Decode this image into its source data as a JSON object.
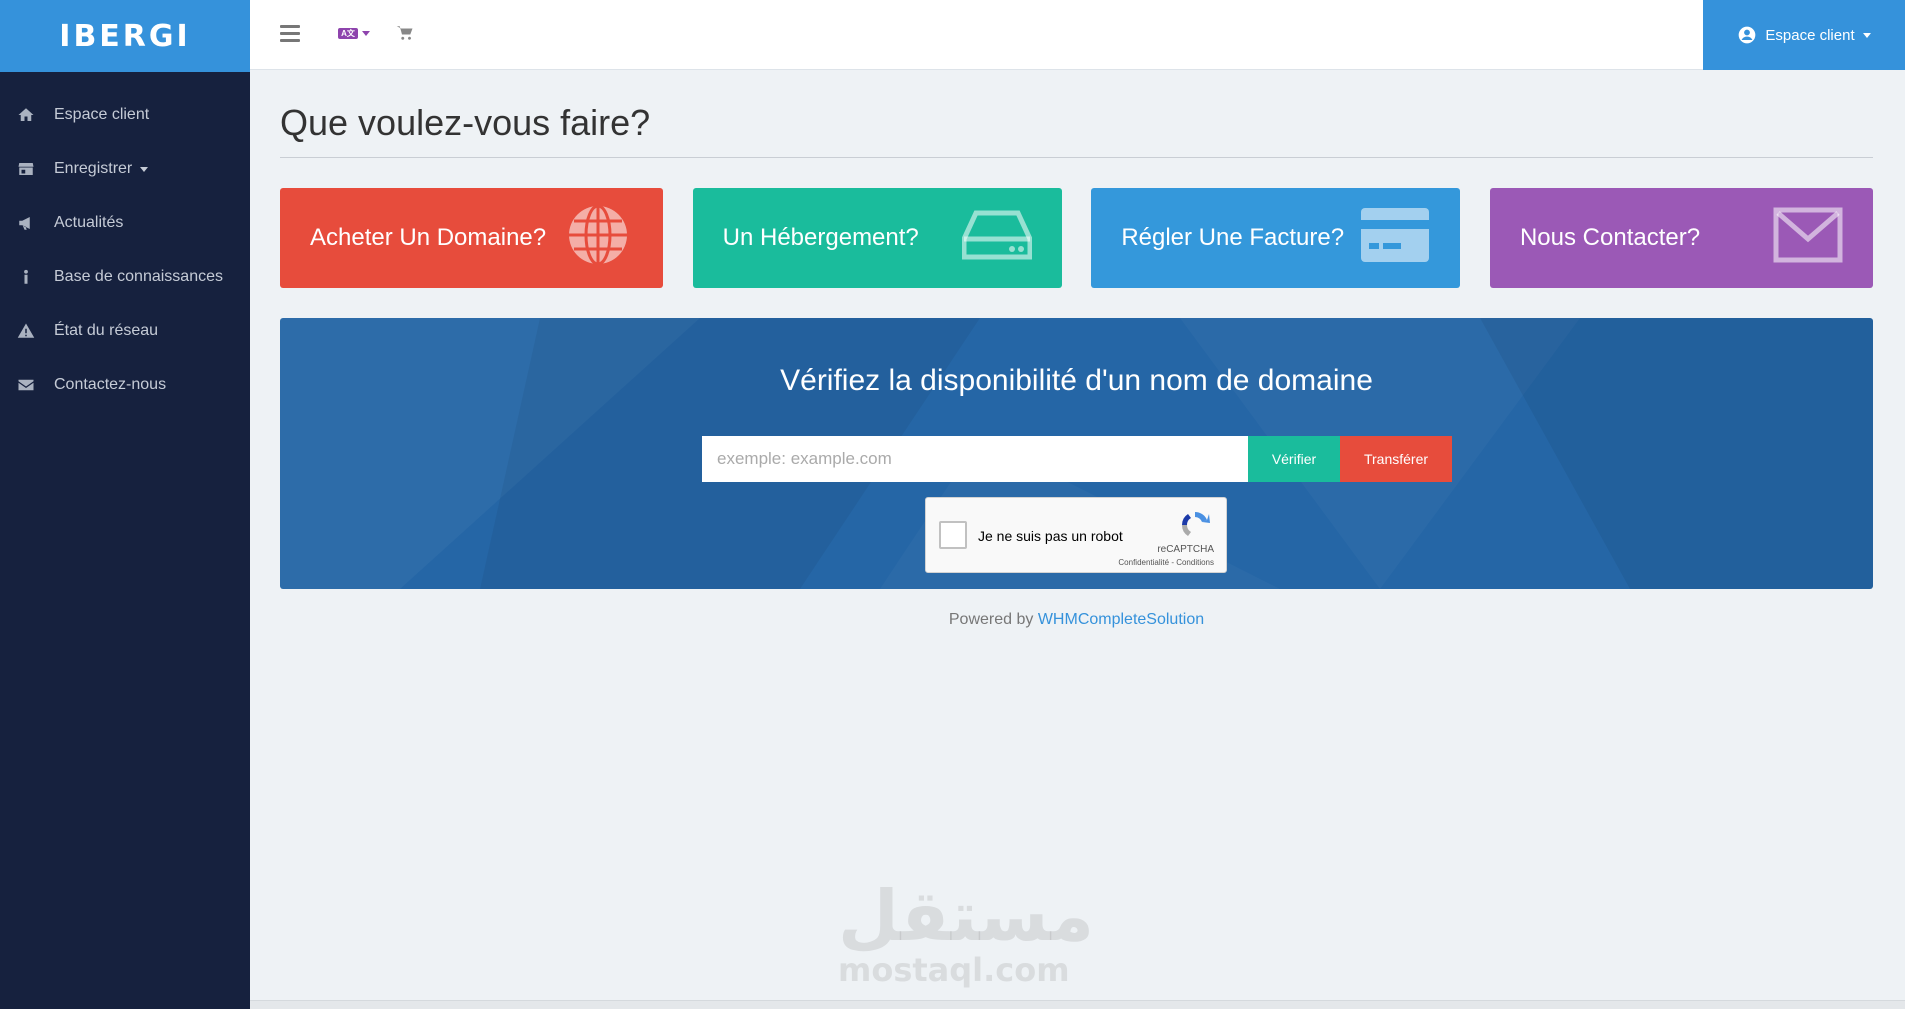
{
  "brand": {
    "logo": "IBERGI"
  },
  "sidebar": {
    "items": [
      {
        "label": "Espace client",
        "icon": "home-icon"
      },
      {
        "label": "Enregistrer",
        "icon": "store-icon",
        "has_caret": true
      },
      {
        "label": "Actualités",
        "icon": "megaphone-icon"
      },
      {
        "label": "Base de connaissances",
        "icon": "info-icon"
      },
      {
        "label": "État du réseau",
        "icon": "warning-icon"
      },
      {
        "label": "Contactez-nous",
        "icon": "envelope-icon"
      }
    ]
  },
  "topbar": {
    "language_flag": "A文",
    "account_label": "Espace client"
  },
  "main": {
    "title": "Que voulez-vous faire?",
    "cards": [
      {
        "label": "Acheter Un Domaine?",
        "icon": "globe-icon",
        "color": "#e74c3c"
      },
      {
        "label": "Un Hébergement?",
        "icon": "server-icon",
        "color": "#1abc9c"
      },
      {
        "label": "Régler Une Facture?",
        "icon": "credit-card-icon",
        "color": "#3498db"
      },
      {
        "label": "Nous Contacter?",
        "icon": "envelope-icon",
        "color": "#9b59b6"
      }
    ],
    "domain_search": {
      "title": "Vérifiez la disponibilité d'un nom de domaine",
      "placeholder": "exemple: example.com",
      "verify_label": "Vérifier",
      "transfer_label": "Transférer"
    },
    "captcha": {
      "label": "Je ne suis pas un robot",
      "brand": "reCAPTCHA",
      "links": "Confidentialité - Conditions"
    },
    "footer": {
      "powered_prefix": "Powered by",
      "powered_link": "WHMCompleteSolution"
    }
  },
  "watermark": {
    "arabic": "مستقل",
    "latin": "mostaql.com"
  },
  "colors": {
    "accent": "#3592db",
    "sidebar": "#16213e",
    "domain_bg": "#2566a6"
  }
}
